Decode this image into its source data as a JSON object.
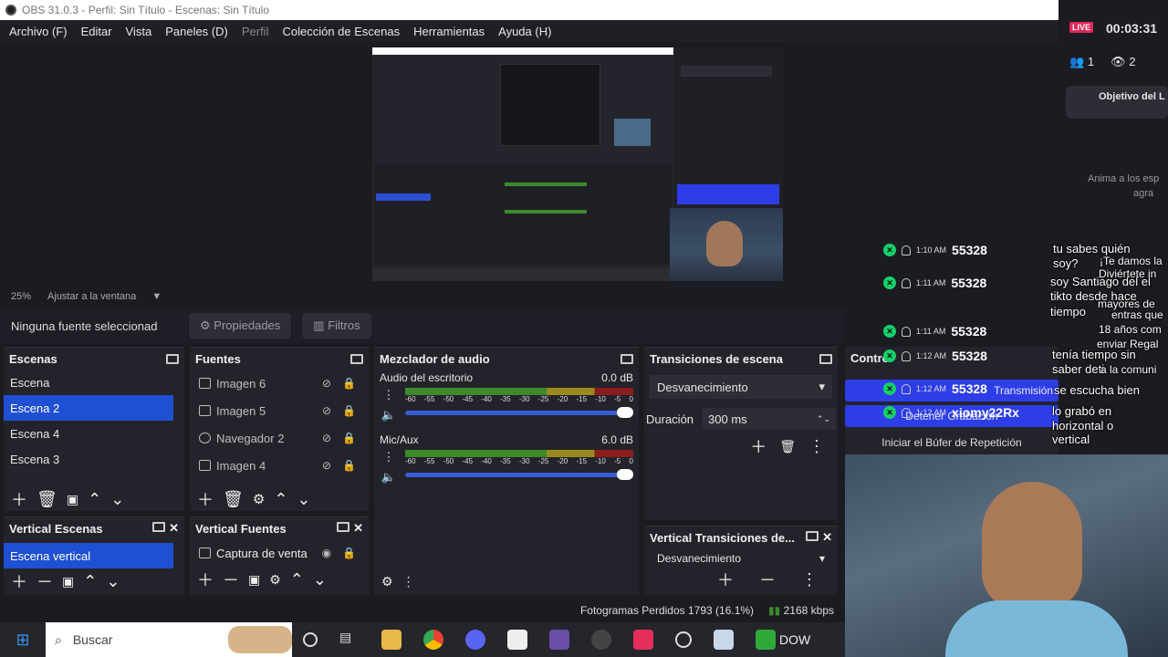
{
  "window": {
    "title": "OBS 31.0.3 - Perfil: Sin Título - Escenas: Sin Título"
  },
  "menu": [
    "Archivo (F)",
    "Editar",
    "Vista",
    "Paneles (D)",
    "Perfil",
    "Colección de Escenas",
    "Herramientas",
    "Ayuda (H)"
  ],
  "zoom": {
    "percent": "25%",
    "fit": "Ajustar a la ventana"
  },
  "toolbar": {
    "no_source": "Ninguna fuente seleccionad",
    "properties": "Propiedades",
    "filters": "Filtros"
  },
  "scenes": {
    "title": "Escenas",
    "items": [
      "Escena",
      "Escena 2",
      "Escena 4",
      "Escena 3"
    ],
    "selected": "Escena 2"
  },
  "sources": {
    "title": "Fuentes",
    "items": [
      "Imagen 6",
      "Imagen 5",
      "Navegador 2",
      "Imagen 4"
    ]
  },
  "mixer": {
    "title": "Mezclador de audio",
    "channels": [
      {
        "name": "Audio del escritorio",
        "db": "0.0 dB"
      },
      {
        "name": "Mic/Aux",
        "db": "6.0 dB"
      }
    ],
    "ticks": [
      "-60",
      "-55",
      "-50",
      "-45",
      "-40",
      "-35",
      "-30",
      "-25",
      "-20",
      "-15",
      "-10",
      "-5",
      "0"
    ]
  },
  "transitions": {
    "title": "Transiciones de escena",
    "selected": "Desvanecimiento",
    "duration_label": "Duración",
    "duration": "300 ms"
  },
  "controls": {
    "title": "Contro",
    "start_stream": "Transmisión",
    "stop_rec": "Detener Grabación",
    "replay": "Iniciar el Búfer de Repetición"
  },
  "vscenes": {
    "title": "Vertical Escenas",
    "items": [
      "Escena vertical"
    ]
  },
  "vsources": {
    "title": "Vertical Fuentes",
    "items": [
      "Captura de venta"
    ]
  },
  "vtransitions": {
    "title": "Vertical Transiciones de...",
    "selected": "Desvanecimiento"
  },
  "status": {
    "dropped": "Fotogramas Perdidos 1793 (16.1%)",
    "bitrate": "2168 kbps"
  },
  "taskbar": {
    "search": "Buscar",
    "dow": "DOW"
  },
  "live": {
    "badge": "LIVE",
    "timer": "00:03:31",
    "viewers": "1",
    "views": "2",
    "goal": "Objetivo del L",
    "encourage": "Anima a los esp",
    "encourage2": "agra"
  },
  "chat": [
    {
      "time": "1:10 AM",
      "user": "55328"
    },
    {
      "time": "1:11 AM",
      "user": "55328"
    },
    {
      "time": "1:11 AM",
      "user": "55328"
    },
    {
      "time": "1:12 AM",
      "user": "55328"
    },
    {
      "time": "1:12 AM",
      "user": "55328"
    },
    {
      "time": "1:12 AM",
      "user": "xiomy22Rx"
    }
  ],
  "overlay": {
    "l1": "tu sabes quién",
    "l2": "soy?",
    "l3": "soy Santiago del el",
    "l4": "tikto desde hace",
    "l5": "tiempo",
    "l6": "tenía tiempo sin",
    "l7": "saber deti",
    "l8": "se escucha bien",
    "l9": "lo grabó en",
    "l10": "horizontal o",
    "l11": "vertical",
    "r1": "¡Te damos la",
    "r2": "Diviértete in",
    "r3": "mayores de",
    "r4": "entras que",
    "r5": "18 años com",
    "r6": "enviar Regal",
    "r7": "a la comuni"
  }
}
